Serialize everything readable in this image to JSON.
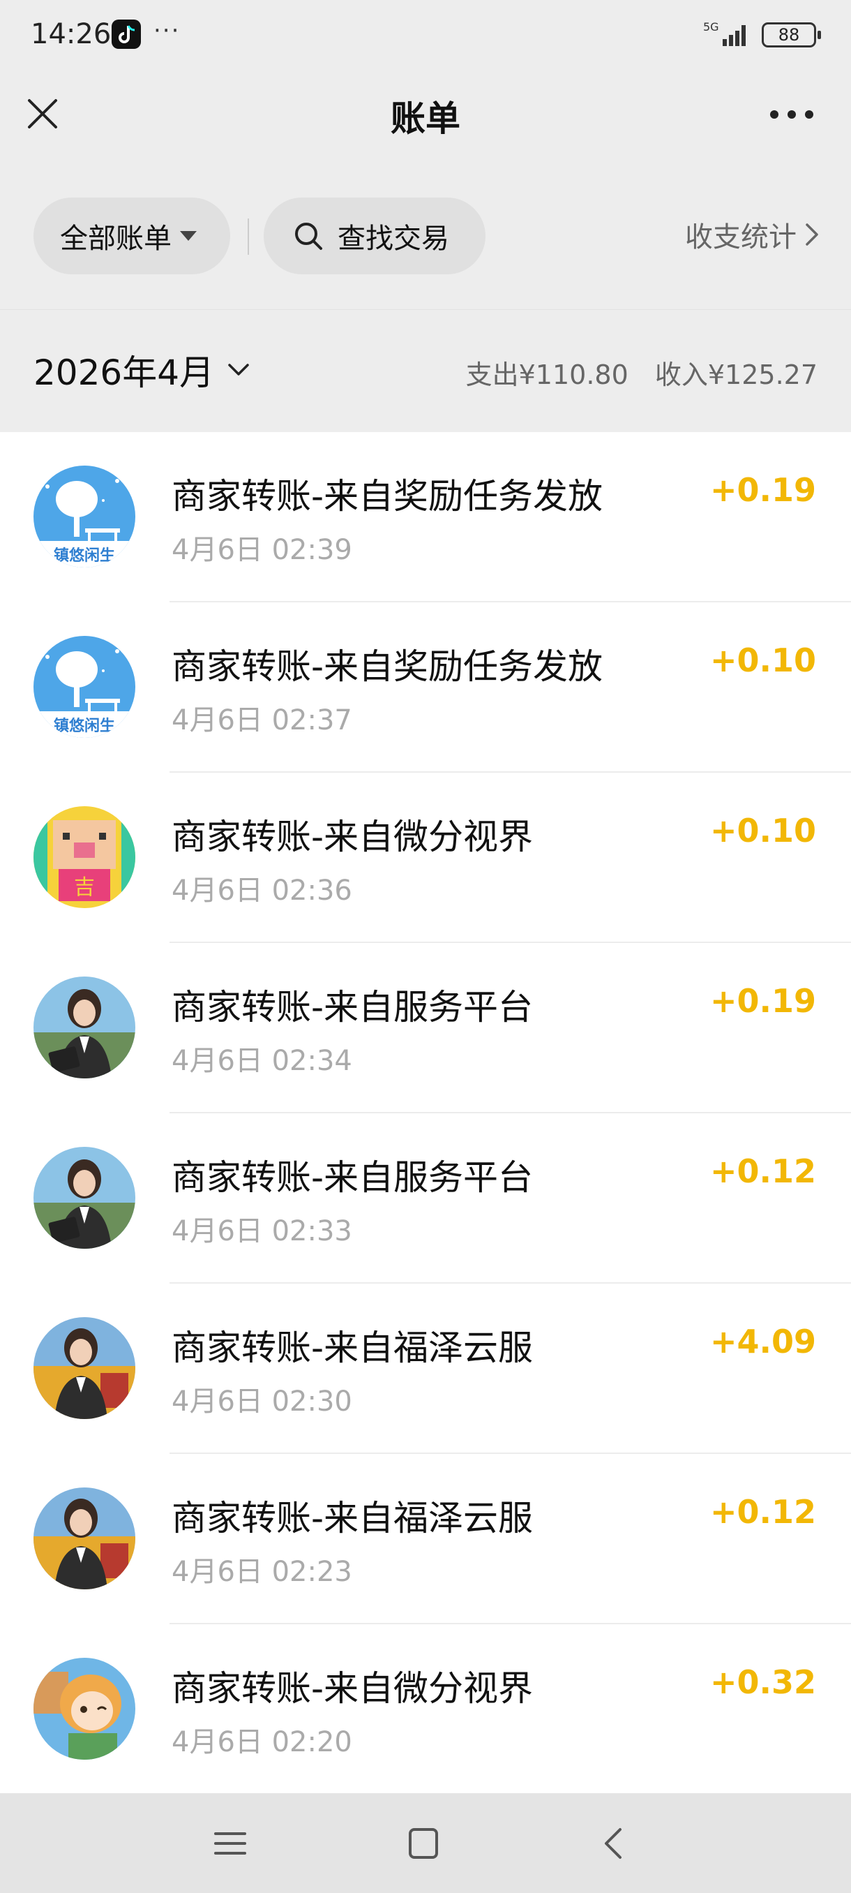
{
  "status_bar": {
    "time": "14:26",
    "dots": "···",
    "network": "5G",
    "battery": "88"
  },
  "nav": {
    "title": "账单"
  },
  "filter": {
    "all_bills": "全部账单",
    "search_placeholder": "查找交易",
    "stats": "收支统计"
  },
  "month": {
    "label": "2026年4月",
    "expense": "支出¥110.80",
    "income": "收入¥125.27"
  },
  "colors": {
    "amount": "#f2b705",
    "background": "#ededed"
  },
  "transactions": [
    {
      "title": "商家转账-来自奖励任务发放",
      "time": "4月6日 02:39",
      "amount": "+0.19",
      "avatar": "town-leisure-avatar",
      "avatar_text": "镇悠闲生"
    },
    {
      "title": "商家转账-来自奖励任务发放",
      "time": "4月6日 02:37",
      "amount": "+0.10",
      "avatar": "town-leisure-avatar",
      "avatar_text": "镇悠闲生"
    },
    {
      "title": "商家转账-来自微分视界",
      "time": "4月6日 02:36",
      "amount": "+0.10",
      "avatar": "pixel-pig-avatar",
      "avatar_text": "吉"
    },
    {
      "title": "商家转账-来自服务平台",
      "time": "4月6日 02:34",
      "amount": "+0.19",
      "avatar": "businesswoman-avatar"
    },
    {
      "title": "商家转账-来自服务平台",
      "time": "4月6日 02:33",
      "amount": "+0.12",
      "avatar": "businesswoman-avatar"
    },
    {
      "title": "商家转账-来自福泽云服",
      "time": "4月6日 02:30",
      "amount": "+4.09",
      "avatar": "businesswoman-field-avatar"
    },
    {
      "title": "商家转账-来自福泽云服",
      "time": "4月6日 02:23",
      "amount": "+0.12",
      "avatar": "businesswoman-field-avatar"
    },
    {
      "title": "商家转账-来自微分视界",
      "time": "4月6日 02:20",
      "amount": "+0.32",
      "avatar": "cartoon-girl-avatar"
    }
  ]
}
